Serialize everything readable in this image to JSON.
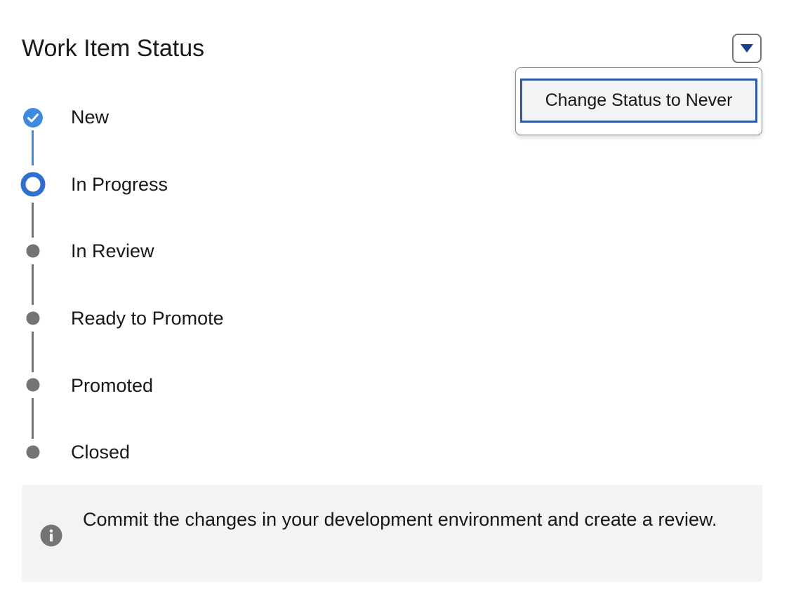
{
  "header": {
    "title": "Work Item Status",
    "menu_icon": "chevron-down-icon"
  },
  "dropdown": {
    "items": [
      {
        "label": "Change Status to Never"
      }
    ]
  },
  "path": {
    "steps": [
      {
        "label": "New",
        "state": "complete",
        "icon": "check-icon"
      },
      {
        "label": "In Progress",
        "state": "current",
        "icon": "ring-icon"
      },
      {
        "label": "In Review",
        "state": "pending",
        "icon": "dot-icon"
      },
      {
        "label": "Ready to Promote",
        "state": "pending",
        "icon": "dot-icon"
      },
      {
        "label": "Promoted",
        "state": "pending",
        "icon": "dot-icon"
      },
      {
        "label": "Closed",
        "state": "pending",
        "icon": "dot-icon"
      }
    ]
  },
  "info": {
    "icon": "info-icon",
    "message": "Commit the changes in your development environment and create a review."
  },
  "colors": {
    "accent": "#2e6fcf",
    "complete": "#3f8ae0",
    "pending": "#747474",
    "focus_border": "#2e5aa6",
    "info_bg": "#f3f3f3"
  }
}
